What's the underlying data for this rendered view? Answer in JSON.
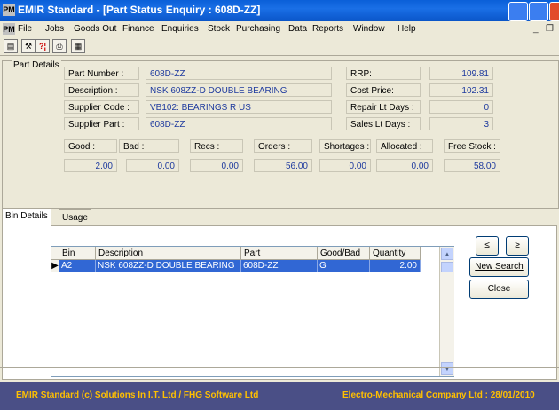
{
  "window": {
    "title": "EMIR Standard - [Part Status Enquiry : 608D-ZZ]",
    "app_icon_text": "PM"
  },
  "menu": [
    "File",
    "Jobs",
    "Goods Out",
    "Finance",
    "Enquiries",
    "Stock",
    "Purchasing",
    "Data",
    "Reports",
    "Window",
    "Help"
  ],
  "mdi_controls": {
    "minimize": "_",
    "restore": "❐"
  },
  "toolbar": {
    "icons": [
      "document-icon",
      "tools-icon",
      "help-icon",
      "printer-icon",
      "calculator-icon"
    ],
    "help_text": "?¦"
  },
  "part_details": {
    "group_label": "Part Details",
    "part_number": {
      "label": "Part Number :",
      "value": "608D-ZZ"
    },
    "description": {
      "label": "Description :",
      "value": "NSK 608ZZ-D DOUBLE BEARING"
    },
    "supplier_code": {
      "label": "Supplier Code :",
      "value": "VB102: BEARINGS R US"
    },
    "supplier_part": {
      "label": "Supplier Part :",
      "value": "608D-ZZ"
    },
    "rrp": {
      "label": "RRP:",
      "value": "109.81"
    },
    "cost_price": {
      "label": "Cost Price:",
      "value": "102.31"
    },
    "repair_lt_days": {
      "label": "Repair Lt Days :",
      "value": "0"
    },
    "sales_lt_days": {
      "label": "Sales Lt Days :",
      "value": "3"
    },
    "stock": {
      "good": {
        "label": "Good :",
        "value": "2.00"
      },
      "bad": {
        "label": "Bad :",
        "value": "0.00"
      },
      "recs": {
        "label": "Recs :",
        "value": "0.00"
      },
      "orders": {
        "label": "Orders :",
        "value": "56.00"
      },
      "shortages": {
        "label": "Shortages :",
        "value": "0.00"
      },
      "allocated": {
        "label": "Allocated :",
        "value": "0.00"
      },
      "free_stock": {
        "label": "Free Stock :",
        "value": "58.00"
      }
    }
  },
  "tabs": [
    {
      "label": "Bin Details",
      "active": true
    },
    {
      "label": "Usage",
      "active": false
    }
  ],
  "grid": {
    "columns": [
      "Bin",
      "Description",
      "Part",
      "Good/Bad",
      "Quantity"
    ],
    "rows": [
      {
        "marker": "▶",
        "bin": "A2",
        "description": "NSK 608ZZ-D DOUBLE BEARING",
        "part": "608D-ZZ",
        "good_bad": "G",
        "quantity": "2.00"
      }
    ],
    "scroll_up": "▲",
    "scroll_down": "▼"
  },
  "buttons": {
    "prev": "≤",
    "next": "≥",
    "new_search": "New Search",
    "close": "Close"
  },
  "status": {
    "left": "EMIR Standard (c) Solutions In I.T. Ltd / FHG Software Ltd",
    "right": "Electro-Mechanical Company Ltd : 28/01/2010"
  },
  "colors": {
    "titlebar": "#0a5fd8",
    "selection": "#3167d4",
    "status_bg": "#4a4f86",
    "status_text": "#ffc000",
    "field_text": "#1e3a9e"
  }
}
